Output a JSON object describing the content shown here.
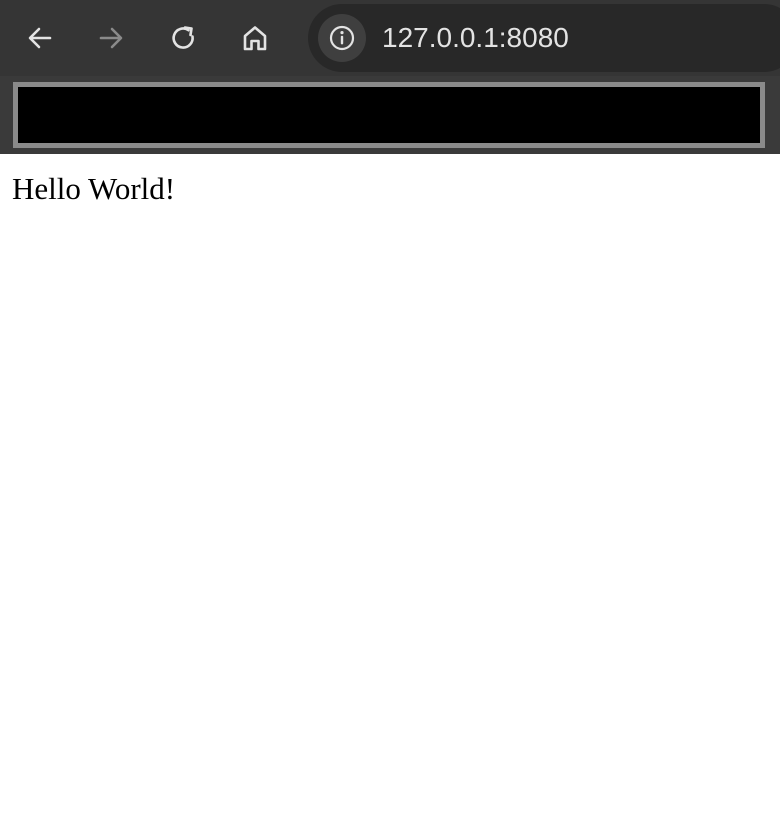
{
  "browser": {
    "address_bar": {
      "url": "127.0.0.1:8080"
    },
    "nav_buttons": {
      "back_enabled": true,
      "forward_enabled": false
    },
    "colors": {
      "toolbar_bg": "#353535",
      "omnibox_bg": "#282828",
      "icon_enabled": "#e3e3e3",
      "icon_disabled": "#8a8a8a"
    }
  },
  "page": {
    "text": "Hello World!"
  }
}
